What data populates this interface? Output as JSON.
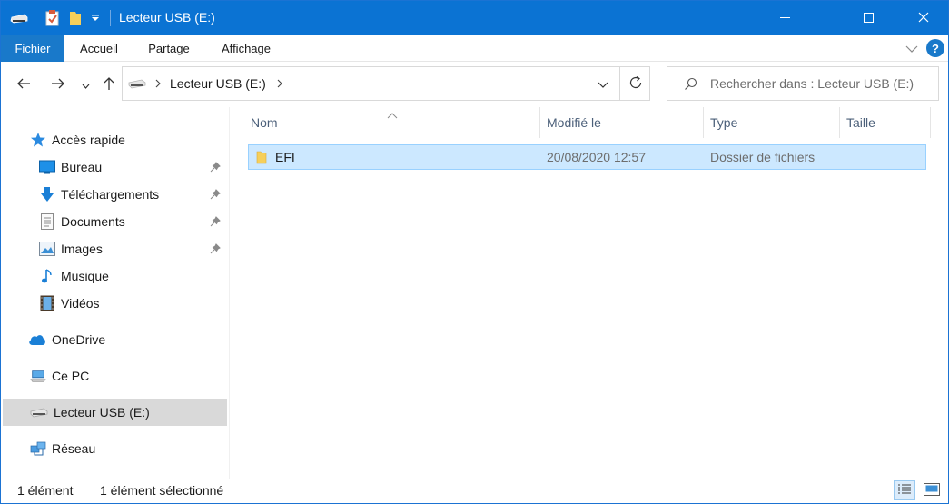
{
  "window": {
    "title": "Lecteur USB (E:)",
    "quick_access": [
      "drive-icon",
      "properties-icon",
      "new-folder-icon",
      "customize-dropdown-icon"
    ],
    "controls": [
      "minimize-icon",
      "maximize-icon",
      "close-icon"
    ]
  },
  "ribbon": {
    "tabs": [
      "Fichier",
      "Accueil",
      "Partage",
      "Affichage"
    ]
  },
  "nav": {
    "breadcrumb": "Lecteur USB (E:)",
    "search_placeholder": "Rechercher dans : Lecteur USB (E:)"
  },
  "sidebar": {
    "items": [
      {
        "label": "Accès rapide",
        "icon": "star-icon"
      },
      {
        "label": "Bureau",
        "icon": "desktop-icon"
      },
      {
        "label": "Téléchargements",
        "icon": "download-icon"
      },
      {
        "label": "Documents",
        "icon": "documents-icon"
      },
      {
        "label": "Images",
        "icon": "images-icon"
      },
      {
        "label": "Musique",
        "icon": "music-icon"
      },
      {
        "label": "Vidéos",
        "icon": "videos-icon"
      },
      {
        "label": "OneDrive",
        "icon": "onedrive-icon"
      },
      {
        "label": "Ce PC",
        "icon": "computer-icon"
      },
      {
        "label": "Lecteur USB (E:)",
        "icon": "usb-drive-icon"
      },
      {
        "label": "Réseau",
        "icon": "network-icon"
      }
    ]
  },
  "list": {
    "columns": [
      "Nom",
      "Modifié le",
      "Type",
      "Taille"
    ],
    "rows": [
      {
        "name": "EFI",
        "modified": "20/08/2020 12:57",
        "type": "Dossier de fichiers",
        "size": ""
      }
    ]
  },
  "status": {
    "count": "1 élément",
    "selected": "1 élément sélectionné"
  },
  "colors": {
    "titlebar": "#0b73d3",
    "file_tab": "#1979ca",
    "selection": "#cce8ff",
    "nav_selected": "#d9d9d9"
  }
}
